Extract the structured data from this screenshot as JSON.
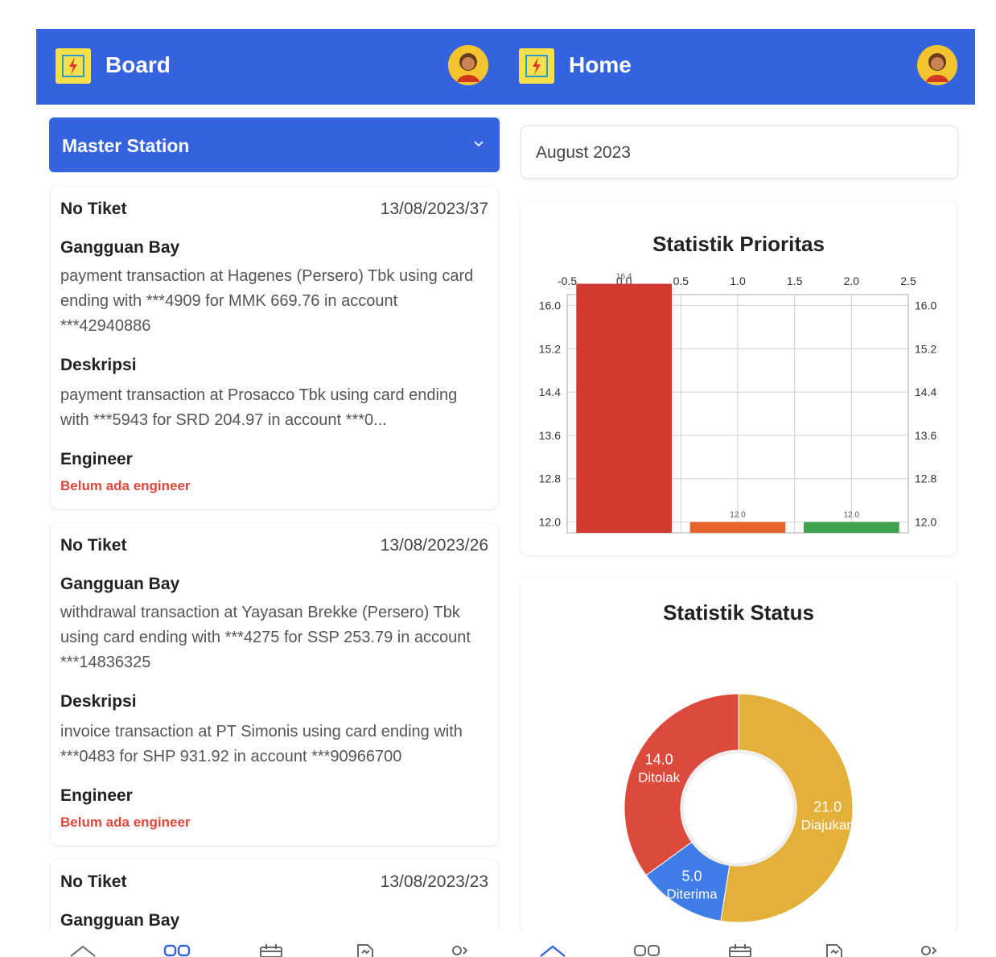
{
  "left": {
    "appbar": {
      "title": "Board"
    },
    "dropdown": {
      "selected": "Master Station"
    },
    "cards": [
      {
        "no_tiket_label": "No Tiket",
        "no_tiket": "13/08/2023/37",
        "gangguan_label": "Gangguan Bay",
        "gangguan_text": "payment transaction at Hagenes (Persero) Tbk using card ending with ***4909 for MMK 669.76 in account ***42940886",
        "deskripsi_label": "Deskripsi",
        "deskripsi_text": "payment transaction at Prosacco Tbk using card ending with ***5943 for SRD 204.97 in account ***0...",
        "engineer_label": "Engineer",
        "engineer_value": "Belum ada engineer"
      },
      {
        "no_tiket_label": "No Tiket",
        "no_tiket": "13/08/2023/26",
        "gangguan_label": "Gangguan Bay",
        "gangguan_text": "withdrawal transaction at Yayasan Brekke (Persero) Tbk using card ending with ***4275 for SSP 253.79 in account ***14836325",
        "deskripsi_label": "Deskripsi",
        "deskripsi_text": "invoice transaction at PT Simonis using card ending with ***0483 for SHP 931.92 in account ***90966700",
        "engineer_label": "Engineer",
        "engineer_value": "Belum ada engineer"
      },
      {
        "no_tiket_label": "No Tiket",
        "no_tiket": "13/08/2023/23",
        "gangguan_label": "Gangguan Bay"
      }
    ],
    "bottom_nav": [
      "home-icon",
      "board-icon",
      "calendar-icon",
      "report-icon",
      "profile-icon"
    ],
    "bottom_nav_active": 1
  },
  "right": {
    "appbar": {
      "title": "Home"
    },
    "month": "August 2023",
    "bottom_nav": [
      "home-icon",
      "board-icon",
      "calendar-icon",
      "report-icon",
      "profile-icon"
    ],
    "bottom_nav_active": 0
  },
  "colors": {
    "primary": "#3562de",
    "danger_text": "#e0473c",
    "bar_red": "#d13a2f",
    "bar_orange": "#e8622b",
    "bar_green": "#3fa34d",
    "donut_gold": "#e3b13a",
    "donut_red": "#dc4a3d",
    "donut_blue": "#3f7de8"
  },
  "chart_data": [
    {
      "type": "bar",
      "title": "Statistik Prioritas",
      "x": [
        0,
        1,
        2
      ],
      "values": [
        16.4,
        12.0,
        12.0
      ],
      "value_labels": [
        "16.4",
        "12.0",
        "12.0"
      ],
      "colors": [
        "#d13a2f",
        "#e8622b",
        "#3fa34d"
      ],
      "xlim": [
        -0.5,
        2.5
      ],
      "ylim": [
        11.8,
        16.2
      ],
      "x_ticks": [
        "-0.5",
        "0.0",
        "0.5",
        "1.0",
        "1.5",
        "2.0",
        "2.5"
      ],
      "y_ticks": [
        "16.0",
        "15.2",
        "14.4",
        "13.6",
        "12.8",
        "12.0"
      ],
      "grid": true,
      "legend": "none"
    },
    {
      "type": "pie",
      "title": "Statistik Status",
      "donut": true,
      "slices": [
        {
          "label": "Diajukan",
          "value": 21.0,
          "value_label": "21.0",
          "color": "#e3b13a"
        },
        {
          "label": "Diterima",
          "value": 5.0,
          "value_label": "5.0",
          "color": "#3f7de8"
        },
        {
          "label": "Ditolak",
          "value": 14.0,
          "value_label": "14.0",
          "color": "#dc4a3d"
        }
      ]
    }
  ]
}
